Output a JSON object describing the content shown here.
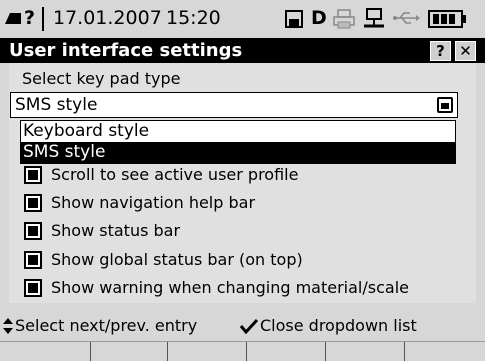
{
  "statusbar": {
    "date": "17.01.2007",
    "time": "15:20",
    "drive_letter": "D",
    "help_glyph": "?",
    "icons": [
      "keyboard-icon",
      "question-icon",
      "save-disk-icon",
      "drive-d-icon",
      "printer-icon",
      "network-icon",
      "usb-icon",
      "battery-icon"
    ]
  },
  "window": {
    "title": "User interface settings",
    "help_button": "?",
    "close_button": "✕"
  },
  "form": {
    "keypad_label": "Select key pad type",
    "keypad_selected": "SMS style",
    "keypad_options": [
      "Keyboard style",
      "SMS style"
    ],
    "checkboxes": [
      {
        "label": "Scroll to see active user profile",
        "checked": true
      },
      {
        "label": "Show navigation help bar",
        "checked": true
      },
      {
        "label": "Show status bar",
        "checked": true
      },
      {
        "label": "Show global status bar (on top)",
        "checked": true
      },
      {
        "label": "Show warning when changing material/scale",
        "checked": true
      }
    ]
  },
  "hints": {
    "nav_icon": "up-down-arrow-icon",
    "nav_text": "Select next/prev. entry",
    "confirm_icon": "checkmark-icon",
    "confirm_text": "Close dropdown list"
  },
  "softkeys": [
    "",
    "",
    "",
    "",
    "",
    ""
  ]
}
